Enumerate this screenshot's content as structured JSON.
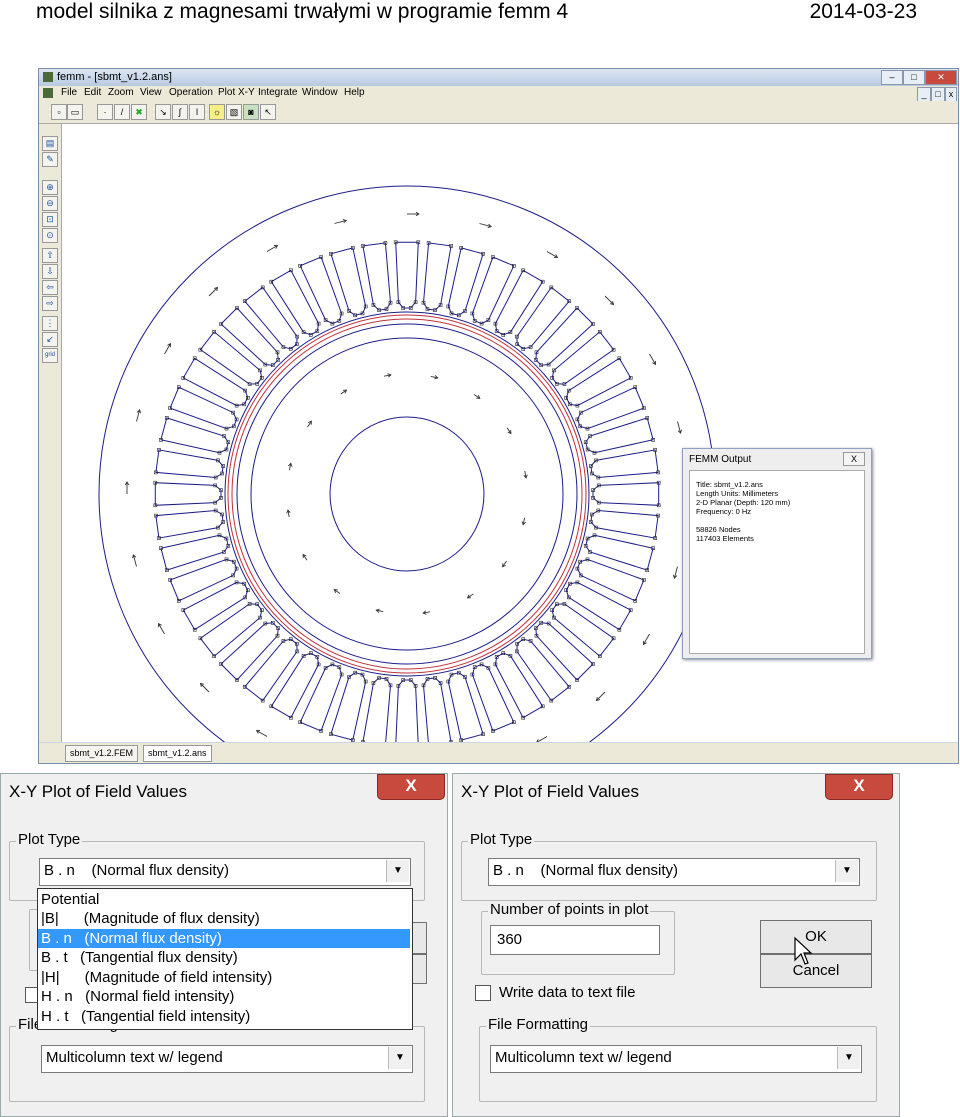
{
  "document": {
    "title": "model silnika z magnesami trwałymi w programie femm 4",
    "date": "2014-03-23"
  },
  "femm_window": {
    "title": "femm - [sbmt_v1.2.ans]",
    "menu": [
      "File",
      "Edit",
      "Zoom",
      "View",
      "Operation",
      "Plot X-Y",
      "Integrate",
      "Window",
      "Help"
    ],
    "tabs": [
      "sbmt_v1.2.FEM",
      "sbmt_v1.2.ans"
    ],
    "toolbar_icons": [
      "new-file-icon",
      "open-file-icon",
      "point-icon",
      "line-icon",
      "block-icon",
      "contour-icon",
      "integral-icon",
      "plot-icon",
      "zoom-icons"
    ],
    "left_icons": [
      "view-results-icon",
      "edit-icon",
      "zoom-in-icon",
      "zoom-out-icon",
      "zoom-window-icon",
      "zoom-natural-icon",
      "pan-up-icon",
      "pan-down-icon",
      "pan-left-icon",
      "pan-right-icon",
      "grid-show-icon",
      "grid-snap-icon",
      "grid-size-icon"
    ]
  },
  "output_dialog": {
    "title": "FEMM Output",
    "close_label": "X",
    "lines": [
      "Title: sbmt_v1.2.ans",
      "Length Units: Millimeters",
      "2-D Planar (Depth: 120 mm)",
      "Frequency: 0 Hz",
      "",
      "58826 Nodes",
      "117403 Elements"
    ]
  },
  "xy_dialog_left": {
    "title": "X-Y Plot of Field Values",
    "close_label": "X",
    "plot_type_label": "Plot Type",
    "plot_type_value": "B . n    (Normal flux density)",
    "dropdown_options": [
      "Potential",
      "|B|      (Magnitude of flux density)",
      "B . n   (Normal flux density)",
      "B . t   (Tangential flux density)",
      "|H|      (Magnitude of field intensity)",
      "H . n   (Normal field intensity)",
      "H . t   (Tangential field intensity)"
    ],
    "dropdown_selected_index": 2,
    "file_formatting_label": "File Formatting",
    "file_formatting_value": "Multicolumn text w/ legend"
  },
  "xy_dialog_right": {
    "title": "X-Y Plot of Field Values",
    "close_label": "X",
    "plot_type_label": "Plot Type",
    "plot_type_value": "B . n    (Normal flux density)",
    "points_label": "Number of points in plot",
    "points_value": "360",
    "ok_label": "OK",
    "cancel_label": "Cancel",
    "write_label": "Write  data to text file",
    "write_checked": false,
    "file_formatting_label": "File Formatting",
    "file_formatting_value": "Multicolumn text w/ legend"
  },
  "colors": {
    "mesh_lines": "#1c1c8a",
    "airgap_red": "#c0303a",
    "selection": "#3399ff",
    "close_button": "#c8493e"
  }
}
